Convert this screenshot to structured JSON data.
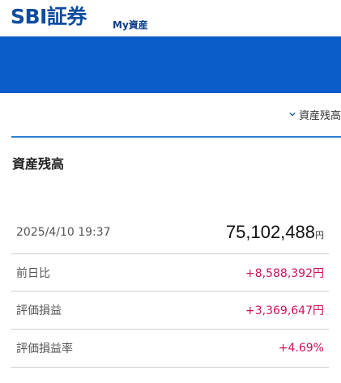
{
  "header": {
    "brand": "SBI証券",
    "section": "My資産"
  },
  "toggle": {
    "label": "資産残高"
  },
  "assets": {
    "title": "資産残高",
    "timestamp": "2025/4/10 19:37",
    "total": "75,102,488",
    "currency": "円",
    "rows": [
      {
        "label": "前日比",
        "value": "+8,588,392円"
      },
      {
        "label": "評価損益",
        "value": "+3,369,647円"
      },
      {
        "label": "評価損益率",
        "value": "+4.69%"
      }
    ]
  },
  "colors": {
    "brand": "#0f4c9e",
    "banner": "#0a5cc9",
    "positive": "#d0105a",
    "rule": "#2a7fd4"
  }
}
